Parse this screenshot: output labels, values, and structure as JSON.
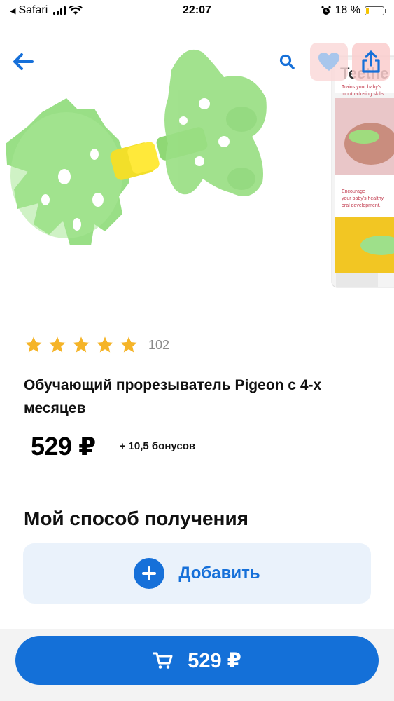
{
  "status_bar": {
    "back_app": "Safari",
    "time": "22:07",
    "battery_percent": "18 %",
    "battery_level": 0.18
  },
  "header": {
    "back_icon": "arrow-left-icon",
    "search_icon": "search-icon",
    "favorite_icon": "heart-icon",
    "share_icon": "share-icon"
  },
  "product": {
    "package_text": "Teethe",
    "package_subtext": "Trains your baby's mouth-closing skills",
    "package_caption": "Encourage your baby's healthy oral development.",
    "rating_stars": 5,
    "rating_count": "102",
    "title": "Обучающий прорезыватель Pigeon с 4-х месяцев",
    "price": "529 ₽",
    "bonus": "+ 10,5 бонусов"
  },
  "delivery": {
    "section_title": "Мой способ получения",
    "add_label": "Добавить"
  },
  "cart": {
    "price": "529 ₽",
    "icon": "cart-icon"
  },
  "colors": {
    "accent": "#1670d9",
    "star": "#f5b428",
    "add_bg": "#eaf2fb"
  }
}
